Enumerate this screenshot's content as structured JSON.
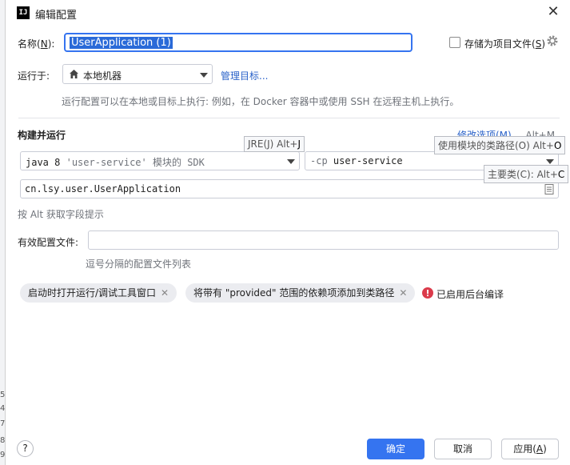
{
  "window": {
    "title": "编辑配置",
    "close_glyph": "✕",
    "logo_text": "IJ"
  },
  "left_strip": {
    "marks": [
      "5",
      "4",
      "7",
      "8",
      "9"
    ]
  },
  "name_row": {
    "label": "名称",
    "mnemonic": "N",
    "value": "UserApplication (1)",
    "store_as_file_label": "存储为项目文件",
    "store_as_file_mnemonic": "S",
    "store_as_file_checked": false
  },
  "run_on": {
    "label": "运行于:",
    "value": "本地机器",
    "manage_link": "管理目标...",
    "hint": "运行配置可以在本地或目标上执行: 例如，在 Docker 容器中或使用 SSH 在远程主机上执行。"
  },
  "build_run": {
    "heading": "构建并运行",
    "modify_options": "修改选项(M)",
    "modify_shortcut": "Alt+M",
    "jre_tooltip_text": "JRE(J) Alt+",
    "jre_tooltip_key": "J",
    "sdk_prefix": "java 8",
    "sdk_module": "'user-service'",
    "sdk_suffix": "模块的 SDK",
    "cp_tooltip_text": "使用模块的类路径(O) Alt+",
    "cp_tooltip_key": "O",
    "cp_flag": "-cp",
    "cp_value": "user-service",
    "main_class_tooltip_text": "主要类(C): Alt+",
    "main_class_tooltip_key": "C",
    "main_class": "cn.lsy.user.UserApplication",
    "alt_hint": "按 Alt 获取字段提示"
  },
  "active_profiles": {
    "label": "有效配置文件:",
    "value": "",
    "hint": "逗号分隔的配置文件列表"
  },
  "chips": [
    {
      "label": "启动时打开运行/调试工具窗口"
    },
    {
      "label": "将带有 \"provided\" 范围的依赖项添加到类路径"
    }
  ],
  "chip_close_glyph": "✕",
  "warning": {
    "text": "已启用后台编译",
    "color": "#db3b4b"
  },
  "footer": {
    "help": "?",
    "ok": "确定",
    "cancel": "取消",
    "apply": "应用",
    "apply_mnemonic": "A"
  }
}
